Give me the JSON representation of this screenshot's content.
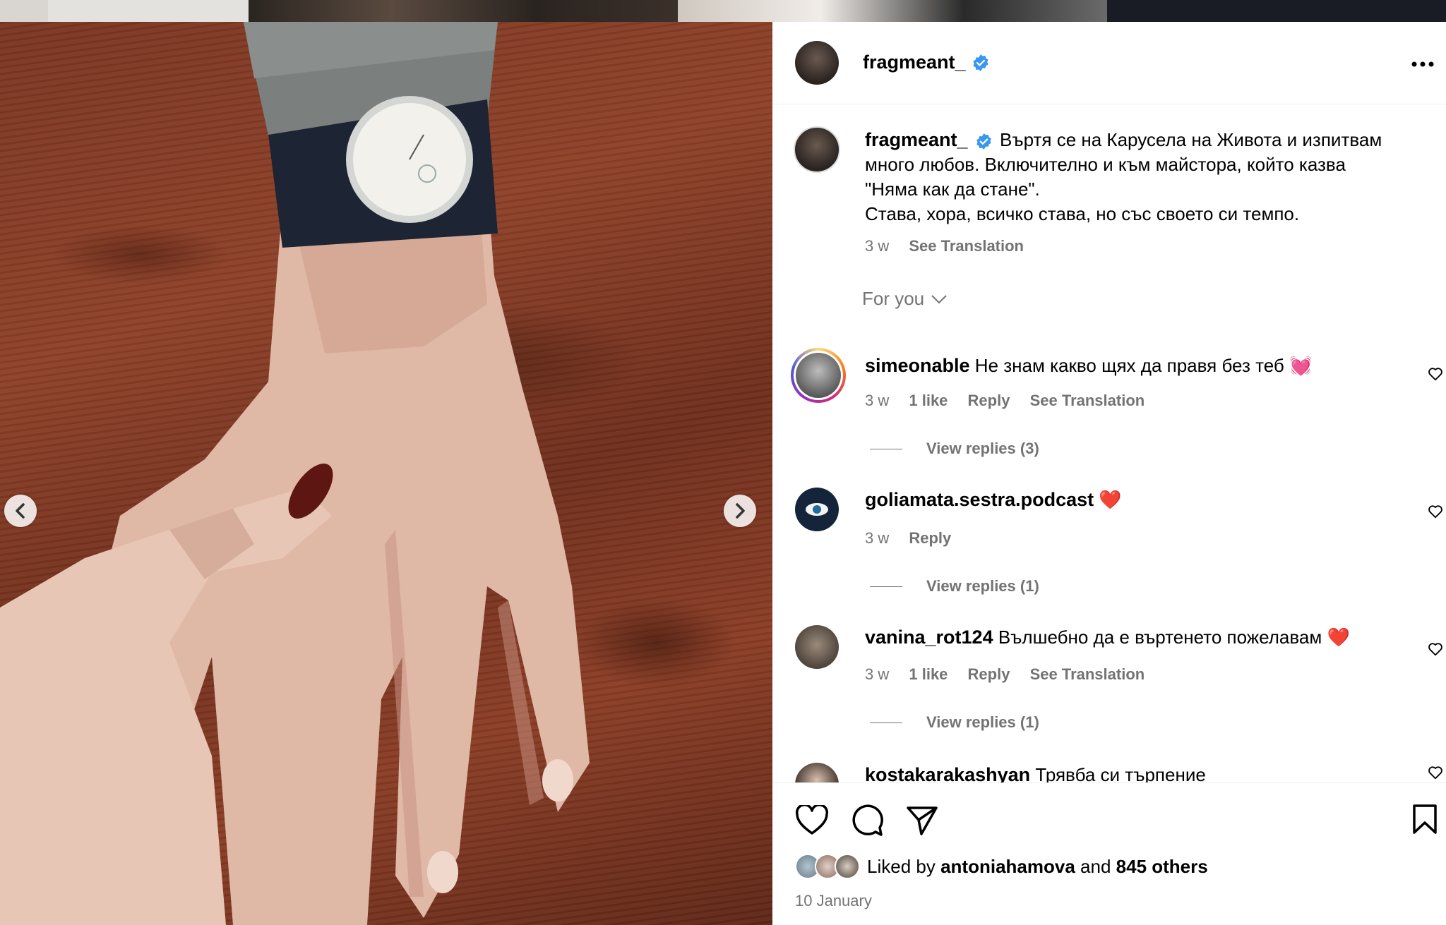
{
  "post": {
    "username": "fragmeant_",
    "caption_lines": [
      "Въртя се на Карусела на Живота и изпитвам",
      "много любов. Включително и към майстора, който казва",
      "\"Няма как да стане\".",
      "Става, хора, всичко става, но със своето си темпо."
    ],
    "caption_time": "3 w",
    "see_translation": "See Translation",
    "more_options_label": "...",
    "date": "10 January"
  },
  "comments_filter": {
    "label": "For you"
  },
  "comments": [
    {
      "username": "simeonable",
      "text": "Не знам какво щях да правя без теб 💓",
      "time": "3 w",
      "likes": "1 like",
      "reply": "Reply",
      "translate": "See Translation",
      "view_replies": "View replies (3)"
    },
    {
      "username": "goliamata.sestra.podcast",
      "text": "❤️",
      "time": "3 w",
      "reply": "Reply",
      "view_replies": "View replies (1)"
    },
    {
      "username": "vanina_rot124",
      "text": "Вълшебно да е въртенето пожелавам ❤️",
      "time": "3 w",
      "likes": "1 like",
      "reply": "Reply",
      "translate": "See Translation",
      "view_replies": "View replies (1)"
    },
    {
      "username": "kostakarakashyan",
      "text": "Трявба си търпение"
    }
  ],
  "likes": {
    "prefix": "Liked by",
    "user": "antoniahamova",
    "and": "and",
    "others": "845 others"
  },
  "colors": {
    "verified": "#3897f0",
    "secondary_text": "#737373",
    "heart_red": "#e0245e"
  },
  "icons": [
    "more-options-icon",
    "verified-icon",
    "heart-icon",
    "comment-icon",
    "share-icon",
    "bookmark-icon",
    "chevron-left-icon",
    "chevron-right-icon",
    "chevron-down-icon"
  ]
}
